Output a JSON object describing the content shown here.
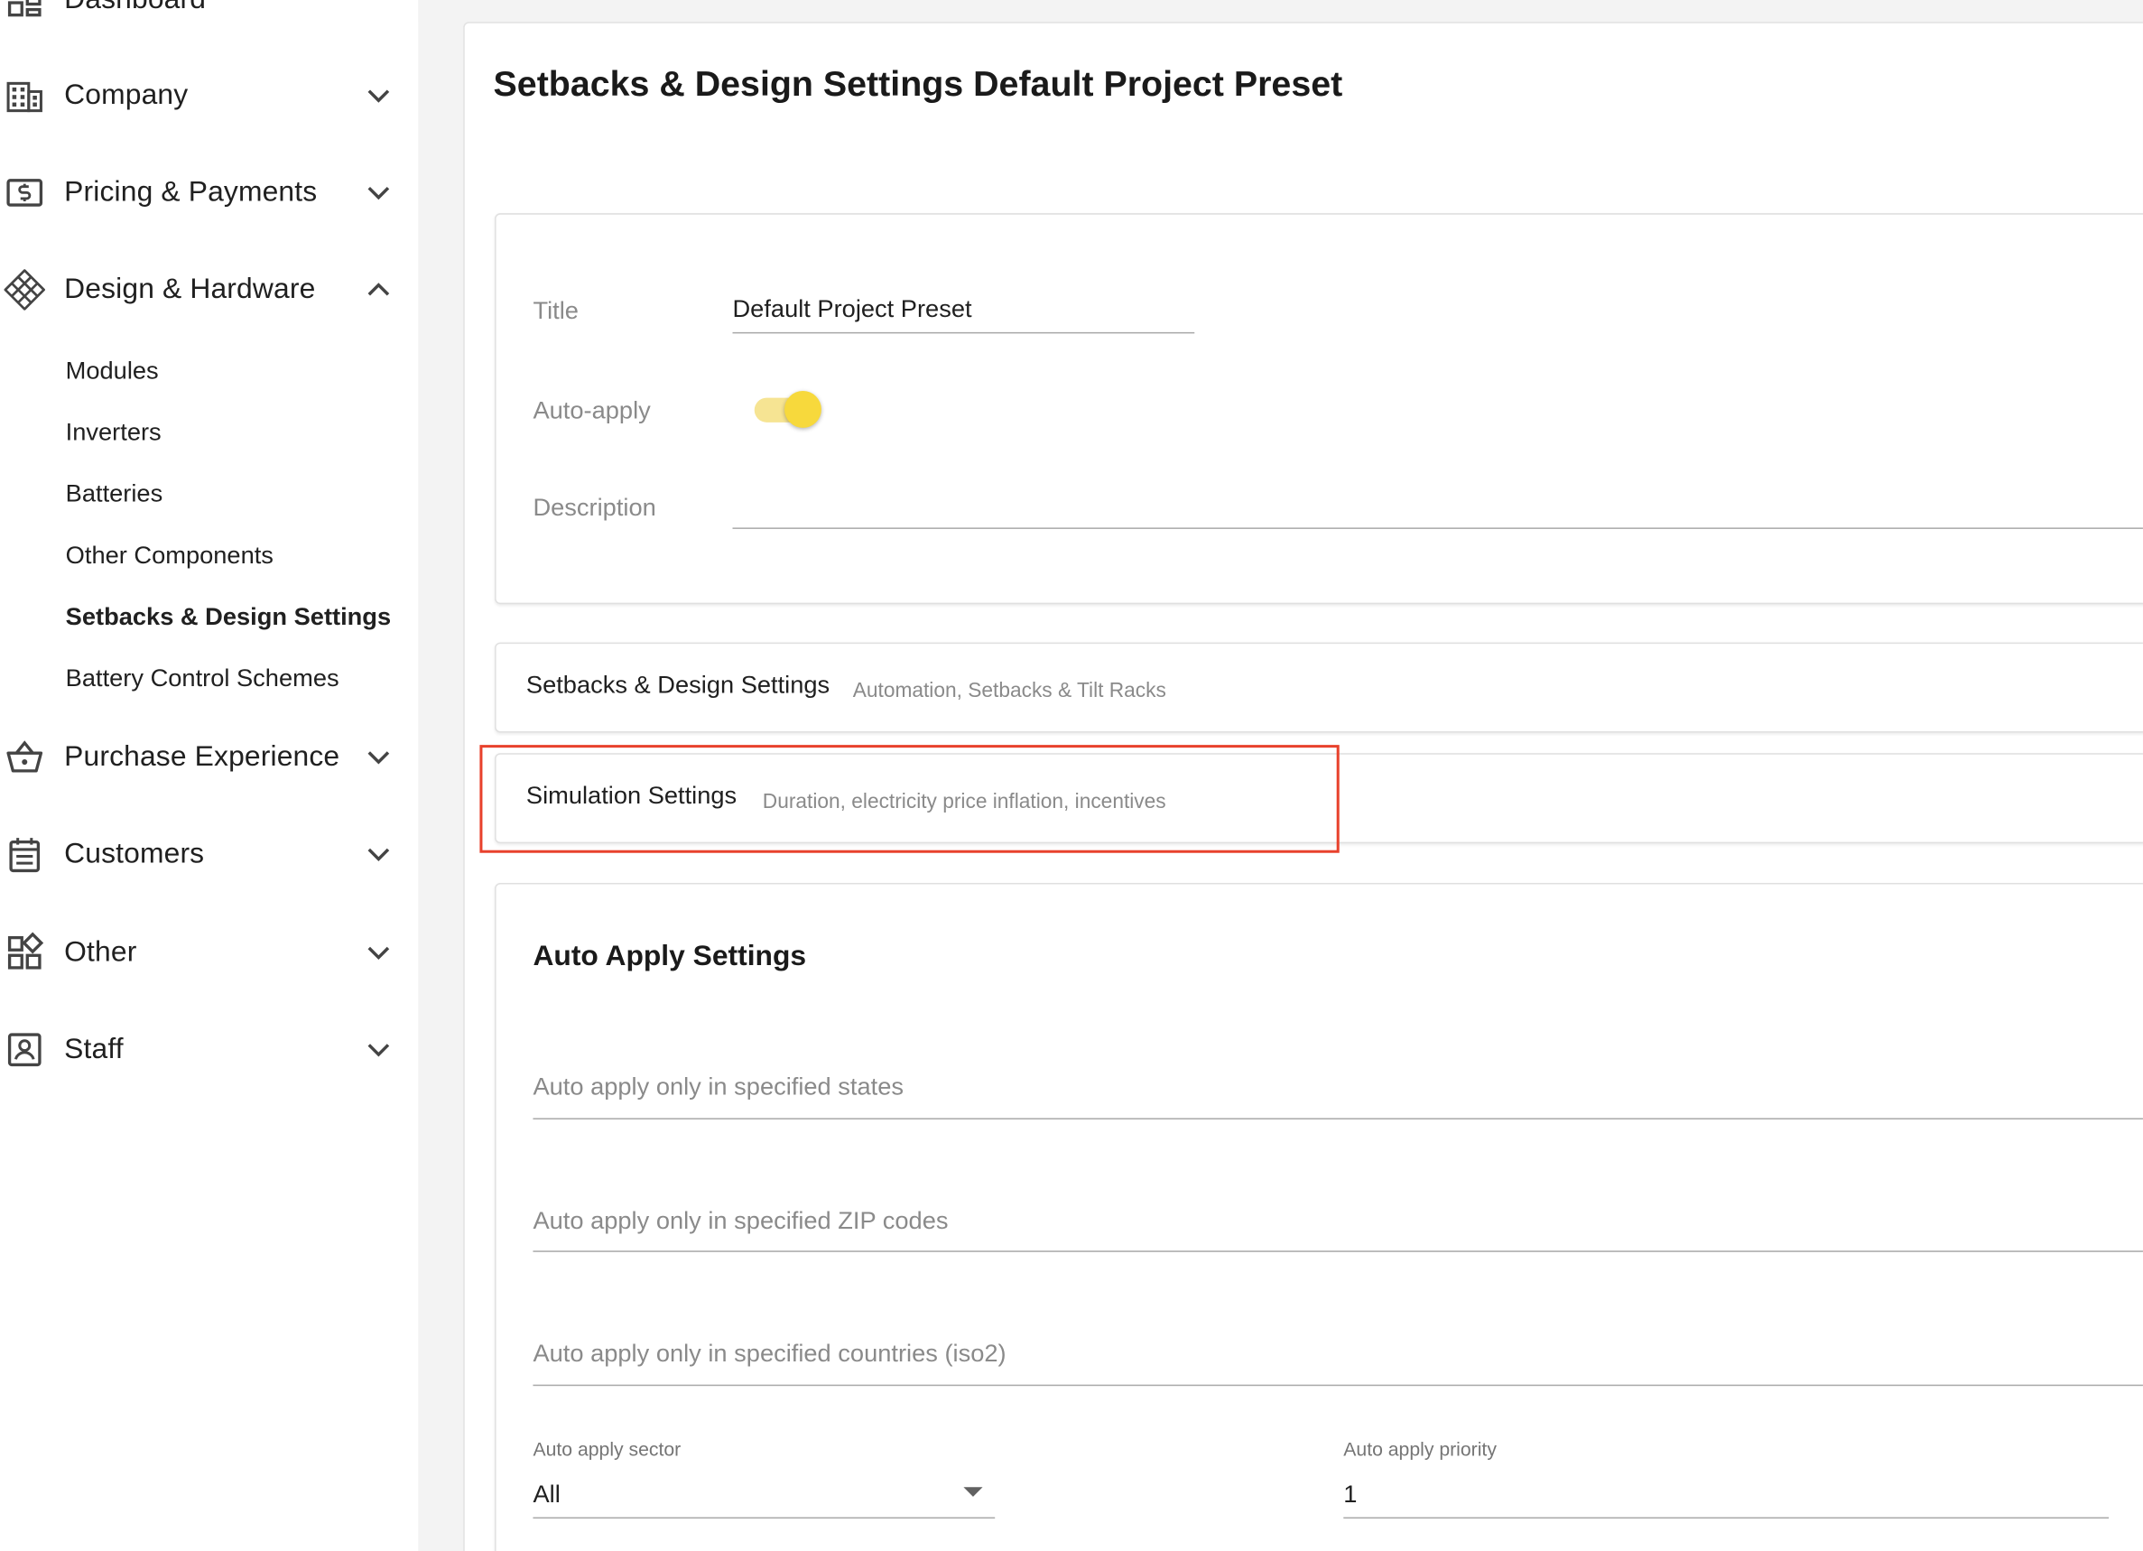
{
  "sidebar": {
    "top_partial_label": "Dashboard",
    "groups": [
      {
        "label": "Company",
        "icon": "building-icon",
        "expanded": false
      },
      {
        "label": "Pricing & Payments",
        "icon": "dollar-bill-icon",
        "expanded": false
      },
      {
        "label": "Design & Hardware",
        "icon": "solar-panel-icon",
        "expanded": true
      },
      {
        "label": "Purchase Experience",
        "icon": "basket-icon",
        "expanded": false
      },
      {
        "label": "Customers",
        "icon": "calendar-list-icon",
        "expanded": false
      },
      {
        "label": "Other",
        "icon": "widgets-icon",
        "expanded": false
      },
      {
        "label": "Staff",
        "icon": "person-badge-icon",
        "expanded": false
      }
    ],
    "design_items": [
      {
        "label": "Modules",
        "active": false
      },
      {
        "label": "Inverters",
        "active": false
      },
      {
        "label": "Batteries",
        "active": false
      },
      {
        "label": "Other Components",
        "active": false
      },
      {
        "label": "Setbacks & Design Settings",
        "active": true
      },
      {
        "label": "Battery Control Schemes",
        "active": false
      }
    ]
  },
  "main": {
    "page_title": "Setbacks & Design Settings Default Project Preset",
    "form": {
      "title_label": "Title",
      "title_value": "Default Project Preset",
      "auto_apply_label": "Auto-apply",
      "auto_apply_on": true,
      "description_label": "Description",
      "description_value": ""
    },
    "accordions": [
      {
        "title": "Setbacks & Design Settings",
        "subtitle": "Automation, Setbacks & Tilt Racks"
      },
      {
        "title": "Simulation Settings",
        "subtitle": "Duration, electricity price inflation, incentives"
      }
    ],
    "auto_apply_settings": {
      "heading": "Auto Apply Settings",
      "states_placeholder": "Auto apply only in specified states",
      "zip_placeholder": "Auto apply only in specified ZIP codes",
      "countries_placeholder": "Auto apply only in specified countries (iso2)",
      "sector_label": "Auto apply sector",
      "sector_value": "All",
      "priority_label": "Auto apply priority",
      "priority_value": "1"
    }
  },
  "colors": {
    "highlight": "#e8412c",
    "toggle_on": "#f7d93c"
  }
}
